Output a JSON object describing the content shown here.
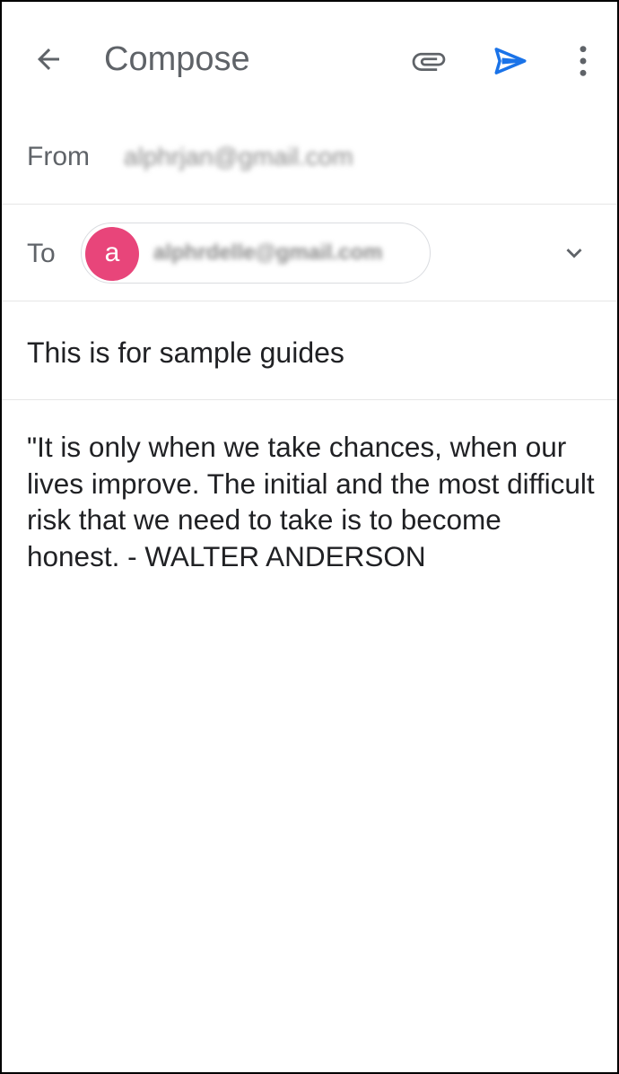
{
  "app_bar": {
    "title": "Compose",
    "icons": {
      "back": "arrow-back-icon",
      "attach": "attachment-icon",
      "send": "send-icon",
      "more": "more-vert-icon"
    },
    "send_color": "#1a73e8"
  },
  "from": {
    "label": "From",
    "value": "alphrjan@gmail.com"
  },
  "to": {
    "label": "To",
    "recipient_initial": "a",
    "recipient_email": "alphrdelle@gmail.com",
    "avatar_color": "#e8457a"
  },
  "subject": "This is for sample guides",
  "body": "\"It is only when we take chances, when our lives improve. The initial and the most difficult risk that we need to take is to become honest. - WALTER ANDERSON"
}
